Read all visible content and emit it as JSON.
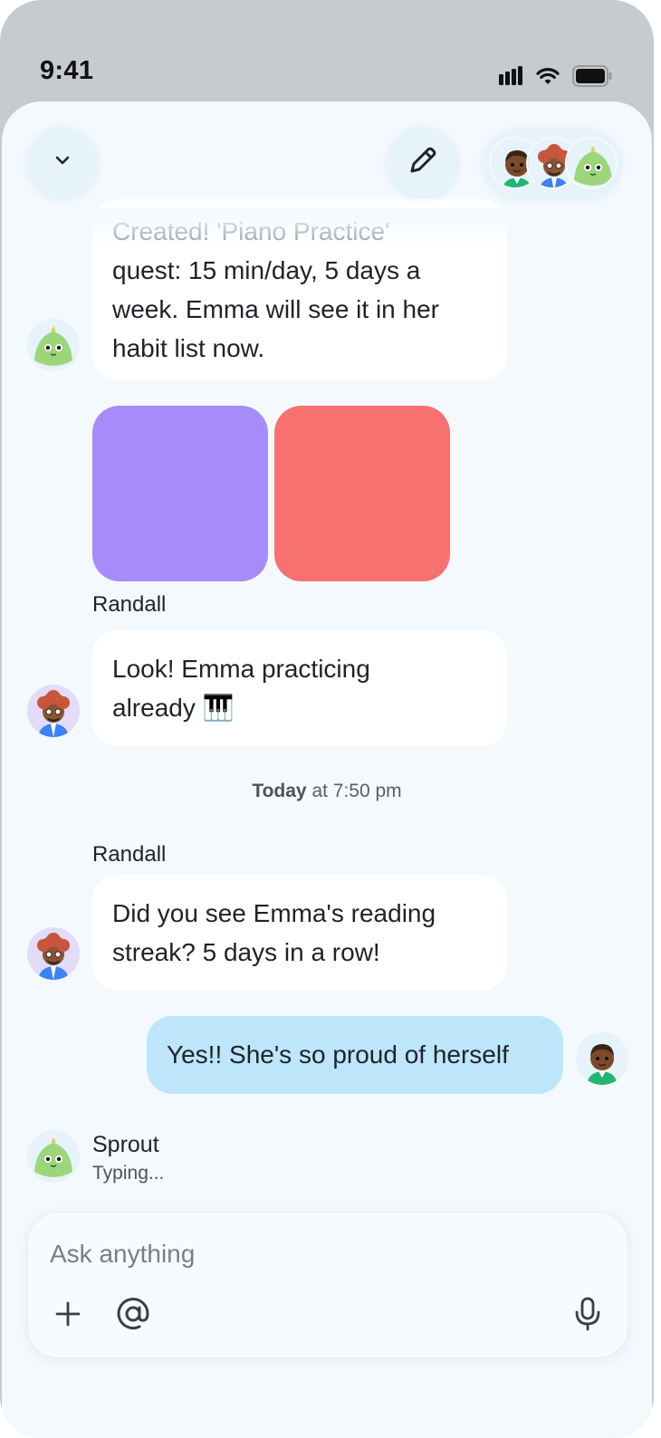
{
  "status_bar": {
    "time": "9:41",
    "icons": [
      "cellular-signal-icon",
      "wifi-icon",
      "battery-icon"
    ]
  },
  "header": {
    "collapse_icon": "chevron-down-icon",
    "edit_icon": "pencil-icon",
    "participants": [
      "Randall-son avatar",
      "Randall",
      "Sprout"
    ]
  },
  "messages": [
    {
      "sender": "Sprout",
      "lines": [
        "Created! 'Piano Practice'",
        "quest: 15 min/day, 5 days a",
        "week. Emma will see it in her",
        "habit list now."
      ]
    },
    {
      "sender": "Randall",
      "attachments": [
        {
          "color": "#a78bfa"
        },
        {
          "color": "#f87171"
        }
      ],
      "lines": [
        "Look! Emma practicing",
        "already 🎹"
      ]
    },
    {
      "timestamp_bold": "Today",
      "timestamp_rest": " at 7:50 pm"
    },
    {
      "sender": "Randall",
      "lines": [
        "Did you see Emma's reading",
        "streak? 5 days in a row!"
      ]
    },
    {
      "sender": "me",
      "text": "Yes!! She's so proud of herself"
    }
  ],
  "typing": {
    "name": "Sprout",
    "status": "Typing..."
  },
  "composer": {
    "placeholder": "Ask anything",
    "value": "",
    "tools": [
      "plus-icon",
      "at-mention-icon",
      "microphone-icon"
    ]
  },
  "colors": {
    "background": "#f4f9fd",
    "incoming_bubble": "#ffffff",
    "outgoing_bubble": "#bde6fb",
    "frame": "#c7cbcf"
  }
}
